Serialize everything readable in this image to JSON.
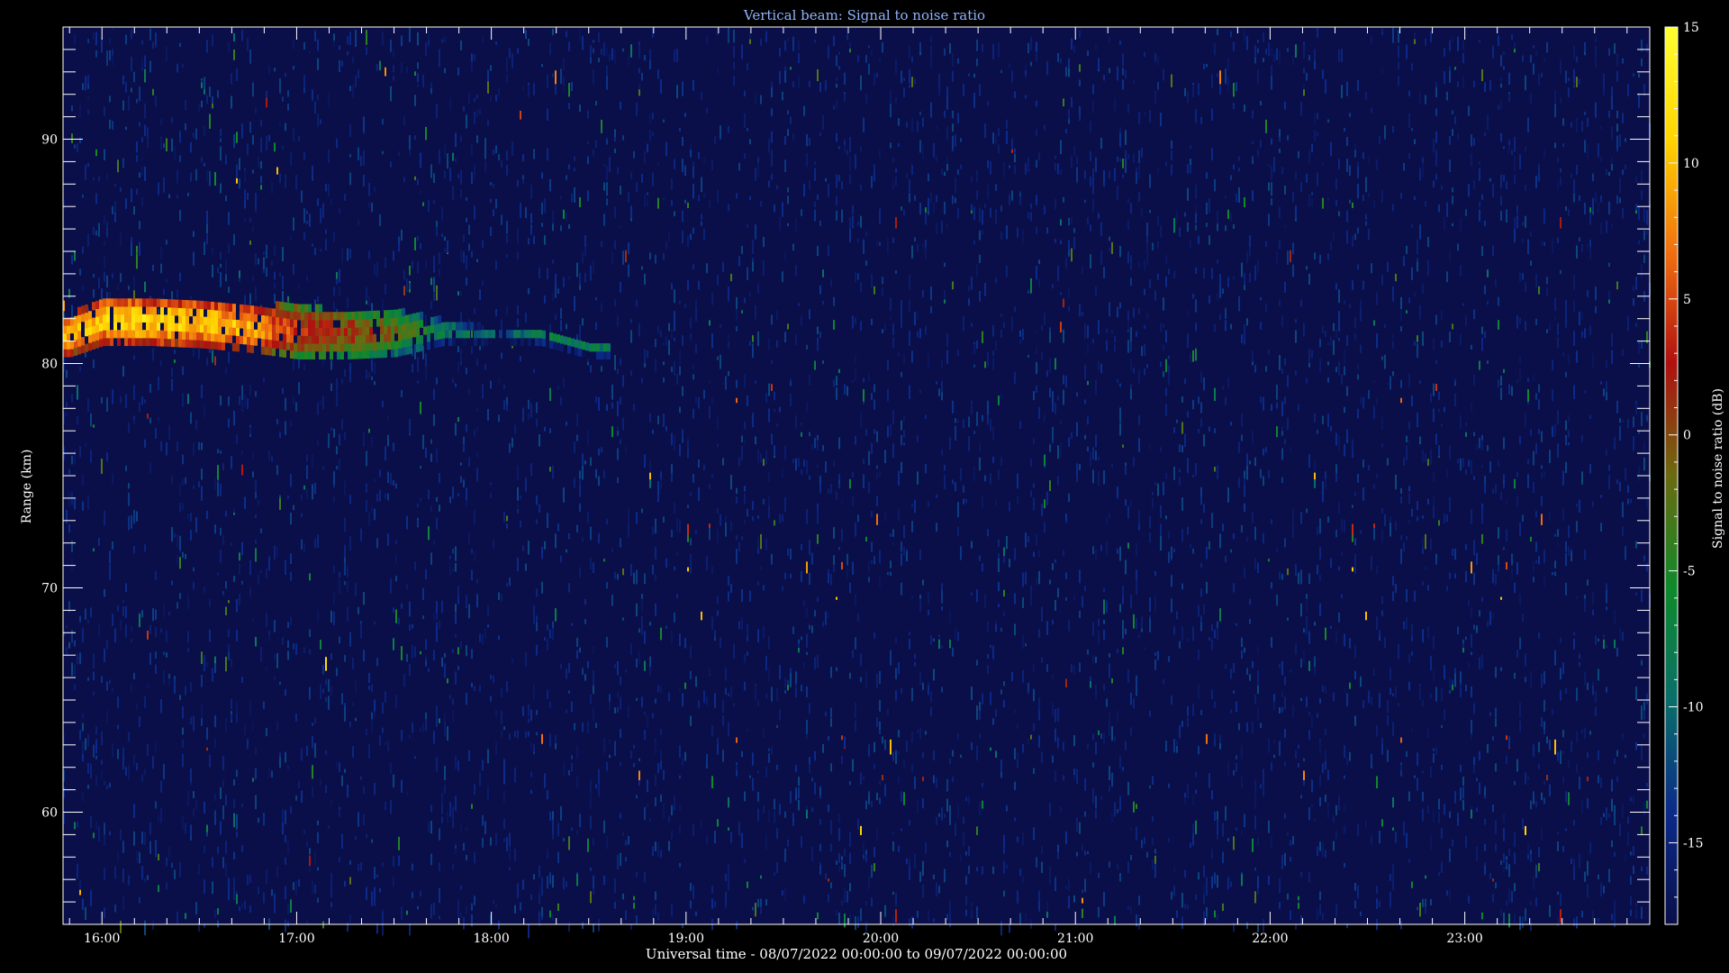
{
  "chart_data": {
    "type": "heatmap",
    "title": "Vertical beam: Signal to noise ratio",
    "xlabel": "Universal time - 08/07/2022 00:00:00 to 09/07/2022 00:00:00",
    "ylabel": "Range (km)",
    "colorbar_label": "Signal to noise ratio (dB)",
    "x_time_range": [
      "15:48",
      "23:57"
    ],
    "x_ticks": [
      "16:00",
      "17:00",
      "18:00",
      "19:00",
      "20:00",
      "21:00",
      "22:00",
      "23:00"
    ],
    "ylim": [
      55,
      95
    ],
    "y_ticks": [
      60,
      70,
      80,
      90
    ],
    "clim": [
      -18,
      15
    ],
    "colorbar_ticks": [
      15,
      10,
      5,
      0,
      -5,
      -10,
      -15
    ],
    "colorscale": [
      "#0a0f4a",
      "#0b2a8a",
      "#0a6f6a",
      "#0e8a2a",
      "#6b6b10",
      "#b01010",
      "#f07010",
      "#ffd400",
      "#ffff30"
    ],
    "background_snr_db": -18,
    "echo_region": {
      "description_time": [
        "15:48",
        "18:36"
      ],
      "samples": [
        {
          "time": "15:50",
          "range_top_km": 82.0,
          "range_bottom_km": 80.3,
          "peak_snr_db": 12
        },
        {
          "time": "16:00",
          "range_top_km": 82.8,
          "range_bottom_km": 80.8,
          "peak_snr_db": 13
        },
        {
          "time": "16:15",
          "range_top_km": 82.6,
          "range_bottom_km": 80.8,
          "peak_snr_db": 14
        },
        {
          "time": "16:30",
          "range_top_km": 82.6,
          "range_bottom_km": 80.7,
          "peak_snr_db": 13
        },
        {
          "time": "16:45",
          "range_top_km": 82.5,
          "range_bottom_km": 80.5,
          "peak_snr_db": 12
        },
        {
          "time": "17:00",
          "range_top_km": 82.4,
          "range_bottom_km": 80.2,
          "peak_snr_db": 6
        },
        {
          "time": "17:15",
          "range_top_km": 82.2,
          "range_bottom_km": 80.2,
          "peak_snr_db": 4
        },
        {
          "time": "17:30",
          "range_top_km": 82.2,
          "range_bottom_km": 80.3,
          "peak_snr_db": 1
        },
        {
          "time": "17:45",
          "range_top_km": 81.8,
          "range_bottom_km": 80.8,
          "peak_snr_db": -5
        },
        {
          "time": "18:00",
          "range_top_km": 81.4,
          "range_bottom_km": 80.8,
          "peak_snr_db": -9
        },
        {
          "time": "18:15",
          "range_top_km": 81.4,
          "range_bottom_km": 80.8,
          "peak_snr_db": -5
        },
        {
          "time": "18:30",
          "range_top_km": 80.8,
          "range_bottom_km": 80.2,
          "peak_snr_db": -6
        }
      ]
    }
  }
}
